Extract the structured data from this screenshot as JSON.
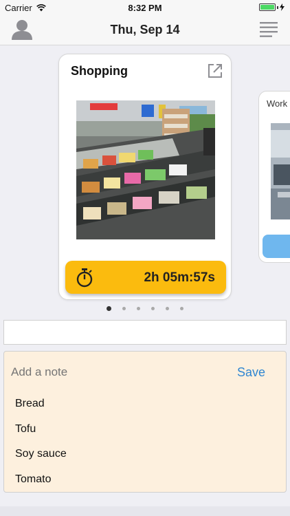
{
  "status_bar": {
    "carrier": "Carrier",
    "time": "8:32 PM",
    "battery_level": 1.0
  },
  "nav": {
    "title": "Thu, Sep 14",
    "left_icon": "person-icon",
    "right_icon": "menu-lines-icon"
  },
  "cards": [
    {
      "title": "Shopping",
      "icon": "open-external-icon",
      "image": "grocery store shelves photo",
      "timer": "2h 05m:57s",
      "timer_icon": "stopwatch-icon",
      "button_color": "#fbbb0e"
    },
    {
      "title": "Work",
      "image": "office desk photo",
      "button_color": "#6fb7ee"
    }
  ],
  "pagination": {
    "count": 6,
    "active_index": 0
  },
  "text_field": {
    "value": ""
  },
  "note": {
    "placeholder": "Add a note",
    "save_label": "Save",
    "items": [
      "Bread",
      "Tofu",
      "Soy sauce",
      "Tomato"
    ]
  },
  "colors": {
    "accent_blue": "#2f86d1",
    "timer_yellow": "#fbbb0e",
    "note_background": "#fdf0de"
  }
}
